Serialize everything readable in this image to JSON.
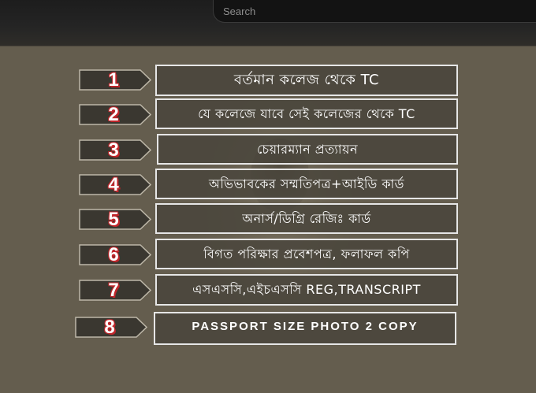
{
  "search": {
    "placeholder": "Search"
  },
  "items": [
    {
      "number": "1",
      "label": "বর্তমান কলেজ থেকে TC"
    },
    {
      "number": "2",
      "label": "যে কলেজে যাবে সেই কলেজের থেকে TC"
    },
    {
      "number": "3",
      "label": "চেয়ারম্যান প্রত্যায়ন"
    },
    {
      "number": "4",
      "label": "অভিভাবকের সম্মতিপত্র+আইডি কার্ড"
    },
    {
      "number": "5",
      "label": "অনার্স/ডিগ্রি রেজিঃ কার্ড"
    },
    {
      "number": "6",
      "label": "বিগত পরিক্ষার প্রবেশপত্র, ফলাফল কপি"
    },
    {
      "number": "7",
      "label": "এসএসসি,এইচএসসি REG,TRANSCRIPT"
    },
    {
      "number": "8",
      "label": "PASSPORT SIZE PHOTO 2 COPY"
    }
  ],
  "colors": {
    "background": "#645d4e",
    "header": "#242424",
    "tag_fill": "#3a3730",
    "number_outline": "#c0252a",
    "box_border": "#e6e6e6"
  }
}
